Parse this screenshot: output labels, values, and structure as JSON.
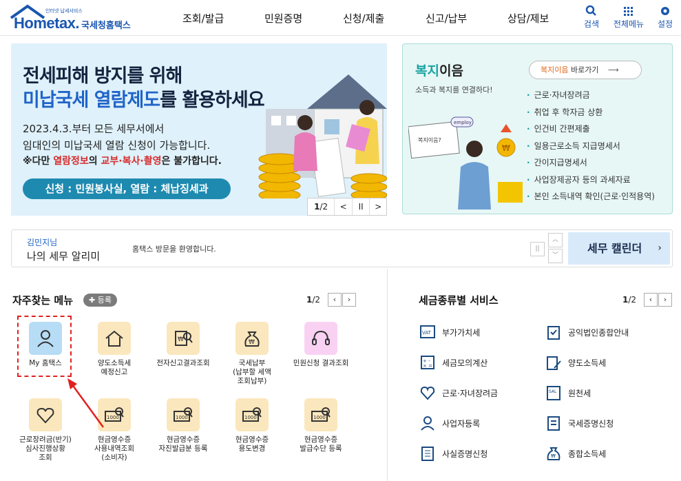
{
  "header": {
    "logo_small": "인터넷 납세서비스",
    "logo_main": "Hometax.",
    "logo_sub": "국세청홈택스",
    "nav": [
      "조회/발급",
      "민원증명",
      "신청/제출",
      "신고/납부",
      "상담/제보"
    ],
    "tools": [
      {
        "label": "검색",
        "icon": "search-icon"
      },
      {
        "label": "전체메뉴",
        "icon": "grid-icon"
      },
      {
        "label": "설정",
        "icon": "gear-icon"
      }
    ]
  },
  "banner": {
    "title1": "전세피해 방지를 위해",
    "title2_hl": "미납국세 열람제도",
    "title2_rest": "를 활용하세요",
    "desc1": "2023.4.3.부터 모든 세무서에서",
    "desc2": "임대인의 미납국세 열람 신청이 가능합니다.",
    "desc3_a": "※다만 ",
    "desc3_b": "열람정보",
    "desc3_c": "의 ",
    "desc3_d": "교부·복사·촬영",
    "desc3_e": "은 불가합니다.",
    "pill": "신청 : 민원봉사실, 열람 : 체납징세과",
    "page_current": "1",
    "page_total": "/2",
    "ctrl_prev": "<",
    "ctrl_pause": "II",
    "ctrl_next": ">"
  },
  "welfare": {
    "title_a": "복지",
    "title_b": "이음",
    "subtitle": "소득과 복지를 연결하다!",
    "btn_a": "복지이음",
    "btn_b": " 바로가기",
    "items": [
      "근로·자녀장려금",
      "취업 후 학자금 상환",
      "인건비 간편제출",
      "일용근로소득 지급명세서",
      "간이지급명세서",
      "사업장제공자 등의 과세자료",
      "본인 소득내역 확인(근로·인적용역)"
    ],
    "illus_card": "복지이음?",
    "illus_tag": "employ"
  },
  "notice": {
    "name": "김민지님",
    "title": "나의 세무 알리미",
    "message": "홈택스 방문을 환영합니다.",
    "calendar": "세무 캘린더",
    "calendar_arrow": "›"
  },
  "freq": {
    "title": "자주찾는 메뉴",
    "register": "등록",
    "page_current": "1",
    "page_total": "/2",
    "tiles": [
      {
        "label": "My 홈택스",
        "icon": "person-icon"
      },
      {
        "label": "양도소득세\n예정신고",
        "icon": "house-icon"
      },
      {
        "label": "전자신고결과조회",
        "icon": "search-doc-icon"
      },
      {
        "label": "국세납부\n(납부할 세액\n조회납부)",
        "icon": "money-bag-icon"
      },
      {
        "label": "민원신청 결과조회",
        "icon": "headset-icon"
      },
      {
        "label": "근로장려금(반기)\n심사진행상황\n조회",
        "icon": "heart-icon"
      },
      {
        "label": "현금영수증\n사용내역조회\n(소비자)",
        "icon": "receipt-icon"
      },
      {
        "label": "현금영수증\n자진발급분 등록",
        "icon": "receipt-icon"
      },
      {
        "label": "현금영수증\n용도변경",
        "icon": "receipt-icon"
      },
      {
        "label": "현금영수증\n발급수단 등록",
        "icon": "receipt-icon"
      }
    ]
  },
  "tax": {
    "title": "세금종류별 서비스",
    "page_current": "1",
    "page_total": "/2",
    "items": [
      {
        "label": "부가가치세",
        "icon": "vat-icon",
        "glyph": "VAT"
      },
      {
        "label": "공익법인종합안내",
        "icon": "clipboard-icon",
        "glyph": ""
      },
      {
        "label": "세금모의계산",
        "icon": "calculator-icon",
        "glyph": ""
      },
      {
        "label": "양도소득세",
        "icon": "doc-pen-icon",
        "glyph": ""
      },
      {
        "label": "근로·자녀장려금",
        "icon": "heart-icon",
        "glyph": ""
      },
      {
        "label": "원천세",
        "icon": "payslip-icon",
        "glyph": "SAL"
      },
      {
        "label": "사업자등록",
        "icon": "person-icon",
        "glyph": ""
      },
      {
        "label": "국세증명신청",
        "icon": "document-icon",
        "glyph": ""
      },
      {
        "label": "사실증명신청",
        "icon": "list-doc-icon",
        "glyph": ""
      },
      {
        "label": "종합소득세",
        "icon": "money-bag-icon",
        "glyph": "₩"
      }
    ]
  },
  "colors": {
    "brand": "#1a56b0",
    "accent": "#1f64c8",
    "highlight": "#e02020",
    "tile_bg": "#fbe7bd",
    "teal": "#18a2a2"
  }
}
